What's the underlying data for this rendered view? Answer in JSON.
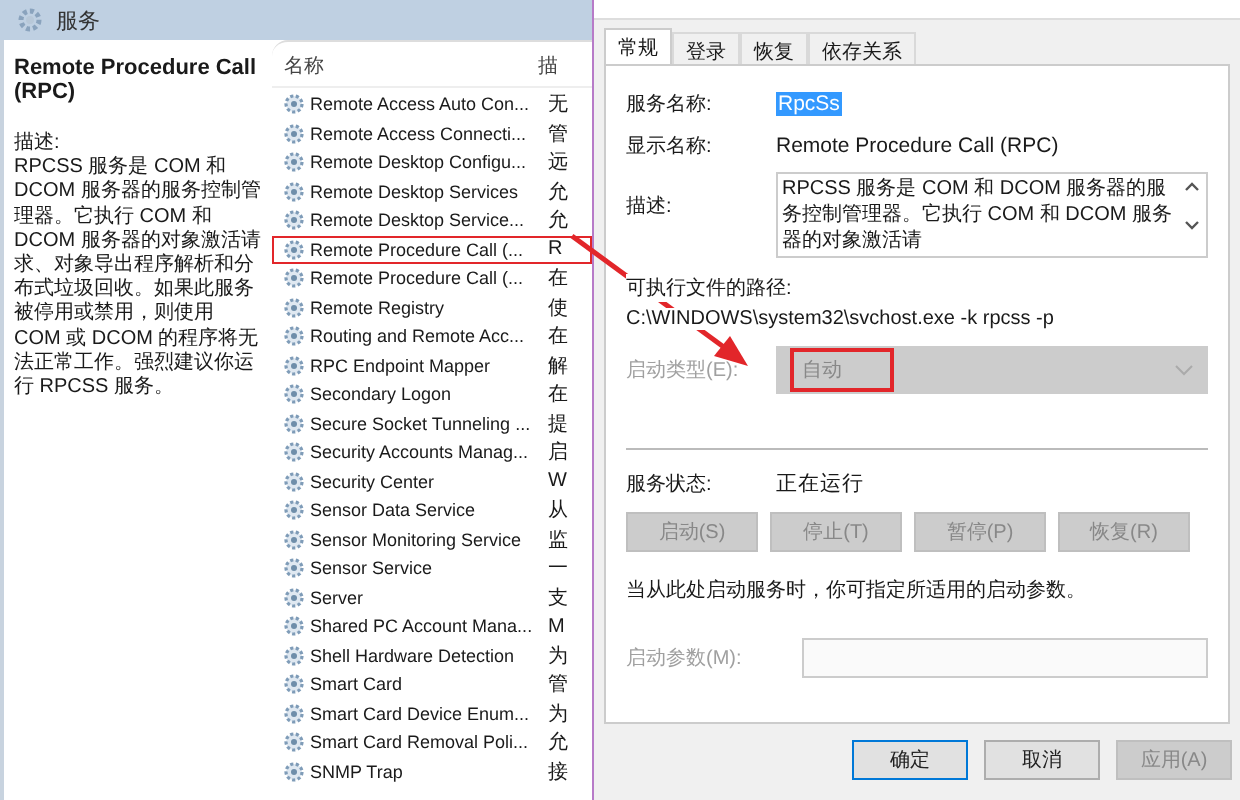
{
  "services_window": {
    "title": "服务",
    "details": {
      "heading": "Remote Procedure Call (RPC)",
      "description_label": "描述:",
      "description": "RPCSS 服务是 COM 和 DCOM 服务器的服务控制管理器。它执行 COM 和 DCOM 服务器的对象激活请求、对象导出程序解析和分布式垃圾回收。如果此服务被停用或禁用，则使用 COM 或 DCOM 的程序将无法正常工作。强烈建议你运行 RPCSS 服务。"
    },
    "list": {
      "column_1": "名称",
      "column_2": "描",
      "rows": [
        {
          "name": "Remote Access Auto Con...",
          "column_2": "无",
          "marked": false
        },
        {
          "name": "Remote Access Connecti...",
          "column_2": "管",
          "marked": false
        },
        {
          "name": "Remote Desktop Configu...",
          "column_2": "远",
          "marked": false
        },
        {
          "name": "Remote Desktop Services",
          "column_2": "允",
          "marked": false
        },
        {
          "name": "Remote Desktop Service...",
          "column_2": "允",
          "marked": false
        },
        {
          "name": "Remote Procedure Call (...",
          "column_2": "R",
          "marked": true
        },
        {
          "name": "Remote Procedure Call (...",
          "column_2": "在",
          "marked": false
        },
        {
          "name": "Remote Registry",
          "column_2": "使",
          "marked": false
        },
        {
          "name": "Routing and Remote Acc...",
          "column_2": "在",
          "marked": false
        },
        {
          "name": "RPC Endpoint Mapper",
          "column_2": "解",
          "marked": false
        },
        {
          "name": "Secondary Logon",
          "column_2": "在",
          "marked": false
        },
        {
          "name": "Secure Socket Tunneling ...",
          "column_2": "提",
          "marked": false
        },
        {
          "name": "Security Accounts Manag...",
          "column_2": "启",
          "marked": false
        },
        {
          "name": "Security Center",
          "column_2": "W",
          "marked": false
        },
        {
          "name": "Sensor Data Service",
          "column_2": "从",
          "marked": false
        },
        {
          "name": "Sensor Monitoring Service",
          "column_2": "监",
          "marked": false
        },
        {
          "name": "Sensor Service",
          "column_2": "一",
          "marked": false
        },
        {
          "name": "Server",
          "column_2": "支",
          "marked": false
        },
        {
          "name": "Shared PC Account Mana...",
          "column_2": "M",
          "marked": false
        },
        {
          "name": "Shell Hardware Detection",
          "column_2": "为",
          "marked": false
        },
        {
          "name": "Smart Card",
          "column_2": "管",
          "marked": false
        },
        {
          "name": "Smart Card Device Enum...",
          "column_2": "为",
          "marked": false
        },
        {
          "name": "Smart Card Removal Poli...",
          "column_2": "允",
          "marked": false
        },
        {
          "name": "SNMP Trap",
          "column_2": "接",
          "marked": false
        }
      ]
    }
  },
  "dialog": {
    "tabs": [
      {
        "label": "常规",
        "selected": true
      },
      {
        "label": "登录",
        "selected": false
      },
      {
        "label": "恢复",
        "selected": false
      },
      {
        "label": "依存关系",
        "selected": false
      }
    ],
    "service_name": {
      "label": "服务名称:",
      "value": "RpcSs"
    },
    "display_name": {
      "label": "显示名称:",
      "value": "Remote Procedure Call (RPC)"
    },
    "description": {
      "label": "描述:",
      "value": "RPCSS 服务是 COM 和 DCOM 服务器的服务控制管理器。它执行 COM 和 DCOM 服务器的对象激活请"
    },
    "path": {
      "label": "可执行文件的路径:",
      "value": "C:\\WINDOWS\\system32\\svchost.exe -k rpcss -p"
    },
    "startup_type": {
      "label": "启动类型(E):",
      "value": "自动",
      "disabled": true,
      "marked": true
    },
    "status": {
      "label": "服务状态:",
      "value": "正在运行"
    },
    "control_buttons": [
      {
        "label": "启动(S)",
        "disabled": true
      },
      {
        "label": "停止(T)",
        "disabled": true
      },
      {
        "label": "暂停(P)",
        "disabled": true
      },
      {
        "label": "恢复(R)",
        "disabled": true
      }
    ],
    "note": "当从此处启动服务时，你可指定所适用的启动参数。",
    "start_params": {
      "label": "启动参数(M):",
      "disabled": true
    },
    "buttons": [
      {
        "label": "确定",
        "default": true,
        "disabled": false
      },
      {
        "label": "取消",
        "default": false,
        "disabled": false
      },
      {
        "label": "应用(A)",
        "default": false,
        "disabled": true
      }
    ]
  }
}
